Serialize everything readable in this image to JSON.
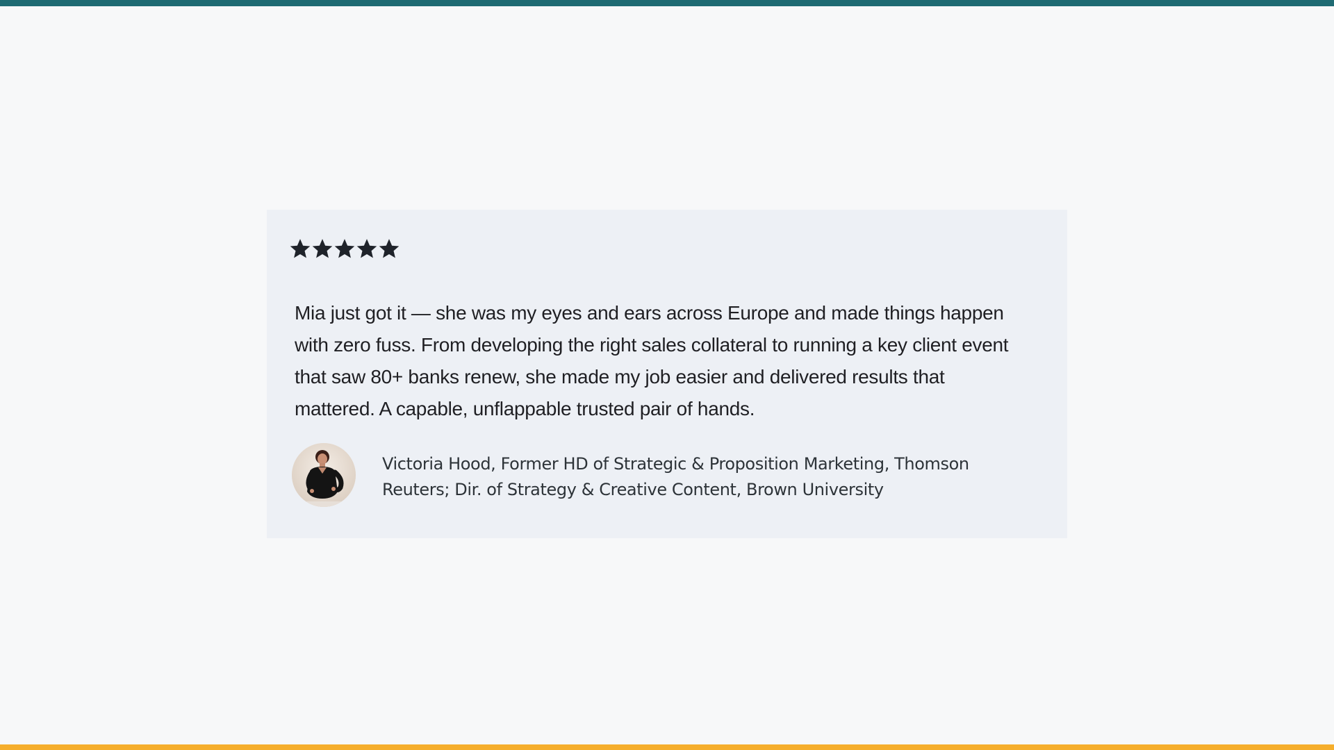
{
  "rating": {
    "stars": 5,
    "max": 5,
    "star_color": "#1f232a"
  },
  "testimonial": {
    "quote": "Mia just got it — she was my eyes and ears across Europe and made things happen with zero fuss. From developing the right sales collateral to running a key client event that saw 80+ banks renew, she made my job easier and delivered results that mattered. A  capable, unflappable trusted pair of hands.",
    "author": "Victoria Hood, Former HD of Strategic & Proposition Marketing, Thomson Reuters; Dir. of Strategy & Creative Content, Brown University"
  },
  "colors": {
    "top_bar": "#1f6b73",
    "bottom_bar": "#f5ae2c",
    "page_background": "#f7f8f9",
    "card_background": "#edf0f5"
  }
}
